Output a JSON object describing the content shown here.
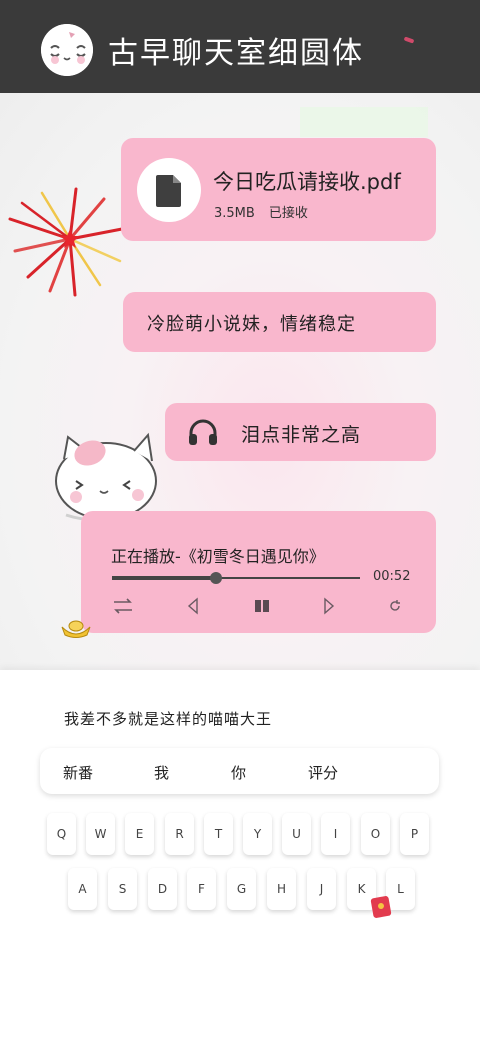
{
  "header": {
    "title": "古早聊天室细圆体"
  },
  "messages": {
    "file": {
      "name": "今日吃瓜请接收.pdf",
      "size": "3.5MB",
      "status": "已接收"
    },
    "text1": "冷脸萌小说妹，情绪稳定",
    "audio": "泪点非常之高",
    "player": {
      "now_playing": "正在播放-《初雪冬日遇见你》",
      "time": "00:52",
      "progress": 0.42
    }
  },
  "input": {
    "composed_text": "我差不多就是这样的喵喵大王",
    "suggestions": [
      "新番",
      "我",
      "你",
      "评分"
    ]
  },
  "keyboard": {
    "row1": [
      "Q",
      "W",
      "E",
      "R",
      "T",
      "Y",
      "U",
      "I",
      "O",
      "P"
    ],
    "row2": [
      "A",
      "S",
      "D",
      "F",
      "G",
      "H",
      "J",
      "K",
      "L"
    ]
  },
  "colors": {
    "header_bg": "#3a3a3a",
    "bubble": "#f9b7cd",
    "accent_red": "#d8232a"
  }
}
